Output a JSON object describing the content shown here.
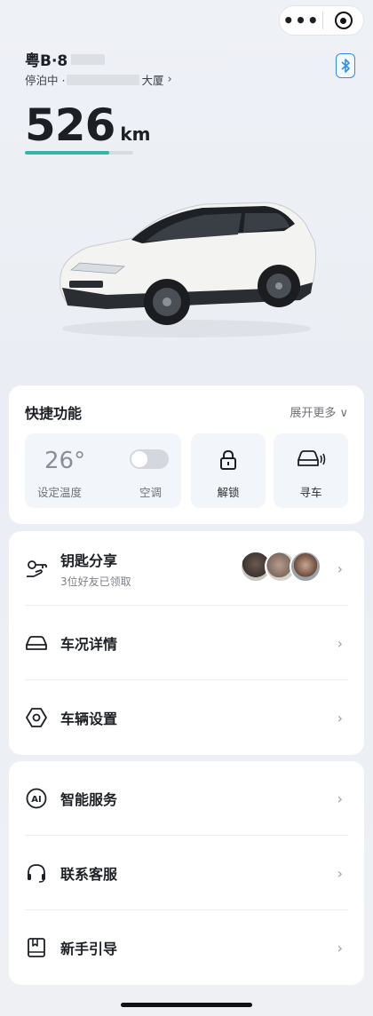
{
  "header": {
    "plate": "粤B·8",
    "parking_status": "停泊中 ·",
    "parking_place": "大厦",
    "range_value": "526",
    "range_unit": "km",
    "range_fraction": 0.78
  },
  "quick": {
    "title": "快捷功能",
    "more": "展开更多 ∨",
    "temperature": "26°",
    "temperature_label": "设定温度",
    "ac_label": "空调",
    "ac_on": false,
    "unlock_label": "解锁",
    "find_label": "寻车"
  },
  "menu1": {
    "key_share": "钥匙分享",
    "key_share_sub": "3位好友已领取",
    "vehicle_status": "车况详情",
    "vehicle_settings": "车辆设置"
  },
  "menu2": {
    "smart_service": "智能服务",
    "customer_service": "联系客服",
    "beginner_guide": "新手引导"
  },
  "colors": {
    "accent": "#35b5a8",
    "bluetooth": "#2d8cf0"
  }
}
